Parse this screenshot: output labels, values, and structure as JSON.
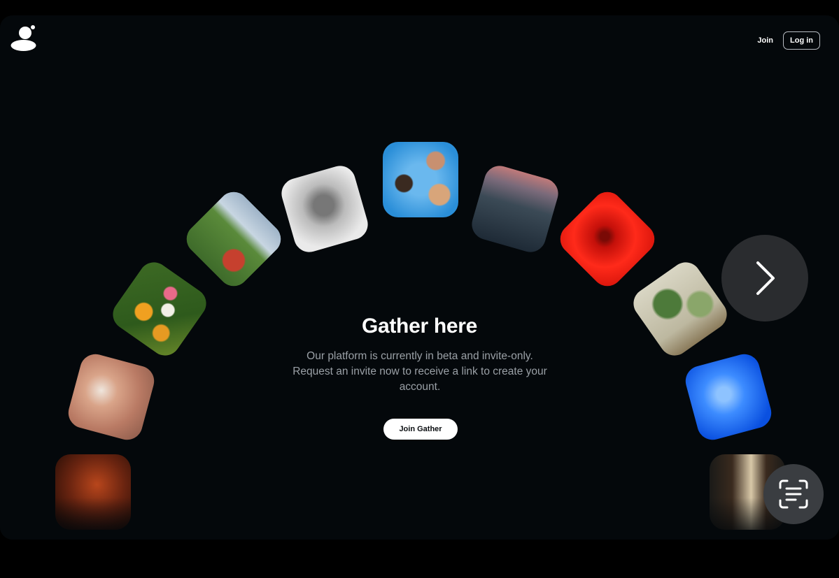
{
  "nav": {
    "join_label": "Join",
    "login_label": "Log in"
  },
  "hero": {
    "title": "Gather here",
    "subtitle": "Our platform is currently in beta and invite-only. Request an invite now to receive a link to create your account.",
    "cta_label": "Join Gather"
  },
  "tiles": [
    {
      "name": "photo-tile-desert-sunset",
      "colors": [
        "#2b0f07",
        "#b8461c",
        "#6a2410"
      ]
    },
    {
      "name": "photo-tile-figurine",
      "colors": [
        "#8a5a4a",
        "#d9a489",
        "#b97a64"
      ]
    },
    {
      "name": "photo-tile-flowers",
      "colors": [
        "#2e5a1c",
        "#e69a22",
        "#f2f0e6"
      ]
    },
    {
      "name": "photo-tile-tent-mountains",
      "colors": [
        "#9fb4c8",
        "#3e6b2a",
        "#c6402e"
      ]
    },
    {
      "name": "photo-tile-portrait-blur",
      "colors": [
        "#eaeaea",
        "#888888",
        "#555555"
      ]
    },
    {
      "name": "photo-tile-friends-sky",
      "colors": [
        "#2a8ed8",
        "#6ab8ee",
        "#d8a57a"
      ]
    },
    {
      "name": "photo-tile-canyon",
      "colors": [
        "#c07a7a",
        "#3b4a56",
        "#1e2a36"
      ]
    },
    {
      "name": "photo-tile-red-eye",
      "colors": [
        "#ff2a1a",
        "#c4100a",
        "#7a0a06"
      ]
    },
    {
      "name": "photo-tile-trees",
      "colors": [
        "#d9d6c4",
        "#4d7a3a",
        "#8aa66a"
      ]
    },
    {
      "name": "photo-tile-jellyfish",
      "colors": [
        "#0a50e0",
        "#3d8cff",
        "#8ec3ff"
      ]
    },
    {
      "name": "photo-tile-library",
      "colors": [
        "#3a2a1e",
        "#d8c8a8",
        "#1a1a18"
      ]
    }
  ],
  "icons": {
    "logo": "person-logo-icon",
    "next": "chevron-right-icon",
    "scan": "text-scan-icon"
  }
}
